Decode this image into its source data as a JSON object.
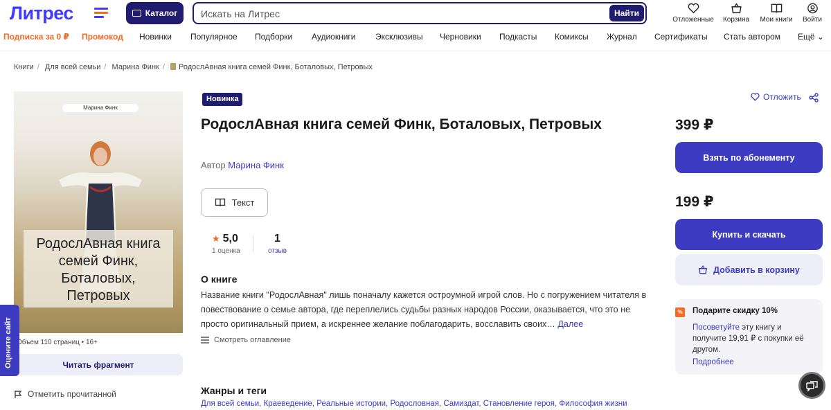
{
  "header": {
    "logo_text": "Литрес",
    "catalog_label": "Каталог",
    "search_placeholder": "Искать на Литрес",
    "search_button": "Найти",
    "icons": [
      {
        "name": "heart-icon",
        "label": "Отложенные"
      },
      {
        "name": "basket-icon",
        "label": "Корзина"
      },
      {
        "name": "book-icon",
        "label": "Мои книги"
      },
      {
        "name": "user-icon",
        "label": "Войти"
      }
    ]
  },
  "nav": {
    "items": [
      "Подписка за 0 ₽",
      "Промокод",
      "Новинки",
      "Популярное",
      "Подборки",
      "Аудиокниги",
      "Эксклюзивы",
      "Черновики",
      "Подкасты",
      "Комиксы",
      "Журнал",
      "Сертификаты",
      "Стать автором",
      "Ещё"
    ],
    "accent_color": "#f26a24"
  },
  "breadcrumbs": [
    "Книги",
    "Для всей семьи",
    "Марина Финк",
    "РодослАвная книга семей Финк, Боталовых, Петровых"
  ],
  "cover": {
    "author": "Марина Финк",
    "title_lines": [
      "РодослАвная книга",
      "семей Финк,",
      "Боталовых,",
      "Петровых"
    ]
  },
  "book_meta": "Объем 110 страниц • 16+",
  "read_fragment": "Читать фрагмент",
  "mark_read": "Отметить прочитанной",
  "rate_site": "Оцените сайт",
  "badge": "Новинка",
  "title": "РодослАвная книга семей Финк, Боталовых, Петровых",
  "author": {
    "prefix": "Автор",
    "name": "Марина Финк"
  },
  "format": "Текст",
  "rating": {
    "value": "5,0",
    "count_label": "1 оценка"
  },
  "reviews": {
    "value": "1",
    "label": "отзыв"
  },
  "about": {
    "heading": "О книге",
    "text": "Название книги \"РодослАвная\" лишь поначалу кажется остроумной игрой слов. Но с погружением читателя в повествование о семье автора, где переплелись судьбы разных народов России, оказывается, что это не просто оригинальный прием, а искреннее желание поблагодарить, восславить своих…",
    "more": "Далее"
  },
  "toc": "Смотреть оглавление",
  "genres": {
    "heading": "Жанры и теги",
    "tags": [
      "Для всей семьи",
      "Краеведение",
      "Реальные истории",
      "Родословная",
      "Самиздат",
      "Становление героя",
      "Философия жизни"
    ]
  },
  "sidebar": {
    "defer": "Отложить",
    "subscription_price": "399 ₽",
    "subscription_button": "Взять по абонементу",
    "buy_price": "199 ₽",
    "buy_button": "Купить и скачать",
    "cart_button": "Добавить в корзину",
    "promo": {
      "badge": "%",
      "heading": "Подарите скидку 10%",
      "link": "Посоветуйте",
      "text": " эту книгу и получите 19,91 ₽ с покупки её другом.",
      "more": "Подробнее"
    }
  },
  "colors": {
    "brand": "#3d3bc2",
    "dark": "#1f1b6e",
    "accent": "#f26a24"
  }
}
